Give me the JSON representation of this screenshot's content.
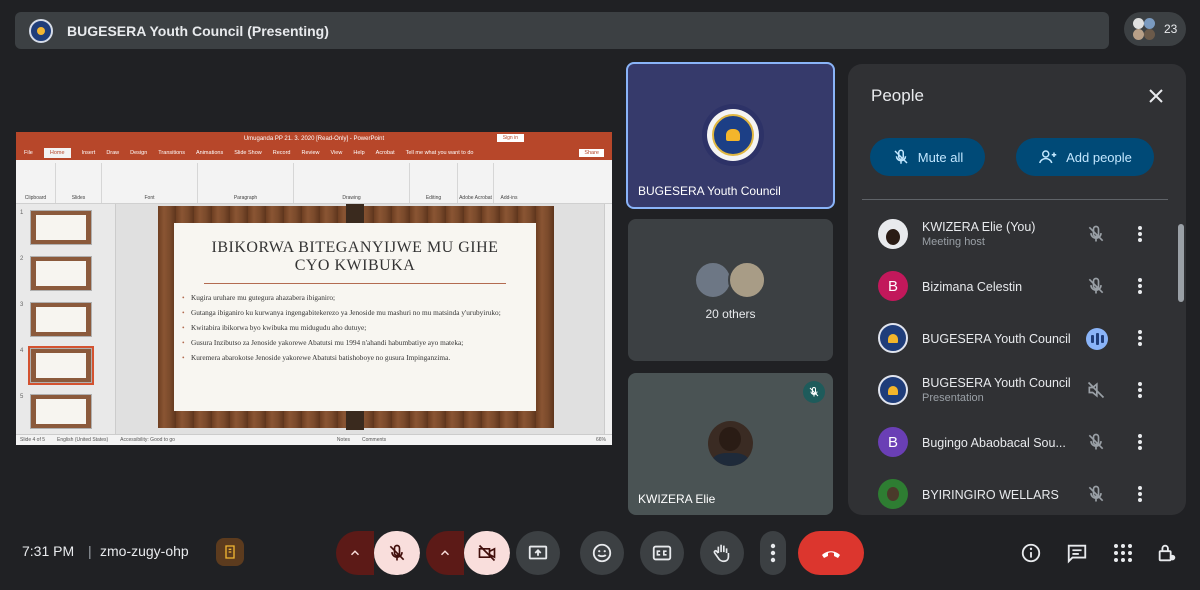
{
  "meeting": {
    "presenting_title": "BUGESERA Youth Council (Presenting)",
    "participant_count": "23",
    "time": "7:31 PM",
    "separator": "|",
    "code": "zmo-zugy-ohp"
  },
  "screen": {
    "window_title": "Umuganda PP 21. 3. 2020 [Read-Only] - PowerPoint",
    "sign_in": "Sign in",
    "menu": [
      "File",
      "Home",
      "Insert",
      "Draw",
      "Design",
      "Transitions",
      "Animations",
      "Slide Show",
      "Record",
      "Review",
      "View",
      "Help",
      "Acrobat",
      "Tell me what you want to do"
    ],
    "share": "Share",
    "ribbon_groups": [
      "Clipboard",
      "Slides",
      "Font",
      "Paragraph",
      "Drawing",
      "Editing",
      "Adobe Acrobat",
      "Add-ins"
    ],
    "slide_numbers": [
      "1",
      "2",
      "3",
      "4",
      "5"
    ],
    "slide_title_line1": "IBIKORWA BITEGANYIJWE MU GIHE",
    "slide_title_line2": "CYO KWIBUKA",
    "bullets": [
      "Kugira uruhare mu gutegura ahazabera ibiganiro;",
      "Gutanga ibiganiro ku kurwanya ingengabitekerezo ya Jenoside mu mashuri no mu matsinda y'urubyiruko;",
      "Kwitabira ibikorwa byo kwibuka mu midugudu aho dutuye;",
      "Gusura Inzibutso za Jenoside yakorewe Abatutsi mu 1994 n'ahandi habumbatiye ayo mateka;",
      "Kuremera abarokotse Jenoside yakorewe Abatutsi batishoboye no gusura Impinganzima."
    ],
    "status_slide": "Slide 4 of 5",
    "status_lang": "English (United States)",
    "status_access": "Accessibility: Good to go",
    "status_notes": "Notes",
    "status_comments": "Comments",
    "zoom": "66%"
  },
  "tiles": {
    "presenter_name": "BUGESERA Youth Council",
    "others_label": "20 others",
    "self_name": "KWIZERA Elie"
  },
  "people": {
    "title": "People",
    "mute_all": "Mute all",
    "add_people": "Add people",
    "list": [
      {
        "name": "KWIZERA Elie (You)",
        "sub": "Meeting host",
        "initial": "",
        "color": "#e8eaed"
      },
      {
        "name": "Bizimana Celestin",
        "sub": "",
        "initial": "B",
        "color": "#c2185b"
      },
      {
        "name": "BUGESERA Youth Council",
        "sub": "",
        "initial": "",
        "color": "#1f3d7a"
      },
      {
        "name": "BUGESERA Youth Council",
        "sub": "Presentation",
        "initial": "",
        "color": "#1f3d7a"
      },
      {
        "name": "Bugingo Abaobacal Sou...",
        "sub": "",
        "initial": "B",
        "color": "#6a3fb5"
      },
      {
        "name": "BYIRINGIRO WELLARS",
        "sub": "",
        "initial": "",
        "color": "#2e7d32"
      }
    ]
  },
  "icons": {
    "mic_off": "mic-off-icon",
    "cam_off": "videocam-off-icon",
    "present": "present-screen-icon",
    "emoji": "emoji-icon",
    "captions": "captions-icon",
    "hand": "raise-hand-icon",
    "more": "more-vert-icon",
    "end": "call-end-icon",
    "info": "info-icon",
    "chat": "chat-icon",
    "activities": "activities-icon",
    "host": "host-controls-icon"
  },
  "colors": {
    "accent_blue": "#8ab4f8",
    "pill_bg": "#004a77",
    "pill_text": "#c2e7ff",
    "muted_red": "#5c1a17",
    "muted_pink": "#f9dedc",
    "end_call": "#dc362e",
    "powerpoint": "#b7472a"
  }
}
